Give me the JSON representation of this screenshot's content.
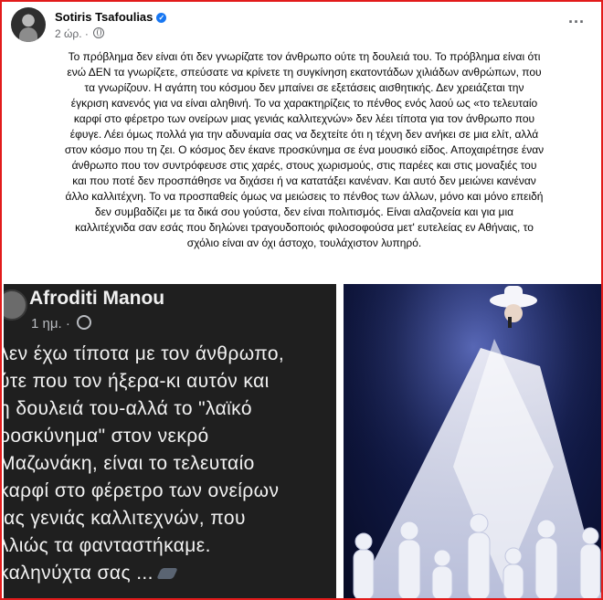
{
  "post": {
    "author": "Sotiris Tsafoulias",
    "time": "2 ώρ.",
    "lines": [
      "Το πρόβλημα δεν είναι ότι δεν γνωρίζατε τον άνθρωπο ούτε τη δουλειά του. Το πρόβλημα είναι ότι",
      "ενώ ΔΕΝ τα γνωρίζετε, σπεύσατε να κρίνετε τη συγκίνηση εκατοντάδων χιλιάδων ανθρώπων, που",
      "τα γνωρίζουν. Η αγάπη του κόσμου δεν μπαίνει σε εξετάσεις αισθητικής. Δεν χρειάζεται την",
      "έγκριση κανενός για να είναι αληθινή. Το να χαρακτηρίζεις το πένθος ενός λαού ως «το τελευταίο",
      "καρφί στο φέρετρο των ονείρων μιας γενιάς καλλιτεχνών» δεν λέει τίποτα για τον άνθρωπο που",
      "έφυγε. Λέει όμως πολλά για την αδυναμία σας να δεχτείτε ότι η τέχνη δεν ανήκει σε μια ελίτ, αλλά",
      "στον κόσμο που τη ζει. Ο κόσμος δεν έκανε προσκύνημα σε ένα μουσικό είδος. Αποχαιρέτησε έναν",
      "άνθρωπο που τον συντρόφευσε στις χαρές, στους χωρισμούς, στις παρέες και στις μοναξιές του",
      "και που ποτέ δεν προσπάθησε να διχάσει ή να κατατάξει κανέναν. Και αυτό δεν μειώνει κανέναν",
      "άλλο καλλιτέχνη. Το να προσπαθείς όμως να μειώσεις το πένθος των άλλων, μόνο και μόνο επειδή",
      "δεν συμβαδίζει με τα δικά σου γούστα, δεν είναι πολιτισμός. Είναι αλαζονεία και για μια",
      "καλλιτέχνιδα σαν εσάς που δηλώνει τραγουδοποιός φιλοσοφούσα μετ' ευτελείας εν Αθήναις, το",
      "σχόλιο είναι αν όχι άστοχο, τουλάχιστον λυπηρό."
    ]
  },
  "comment": {
    "author": "Afroditi Manou",
    "time": "1 ημ.",
    "lines": [
      "λεν έχω τίποτα με τον άνθρωπο,",
      "ύτε που τον ήξερα-κι αυτόν και",
      "η δουλειά του-αλλά το \"λαϊκό",
      "ροσκύνημα\" στον νεκρό",
      "Μαζωνάκη, είναι το τελευταίο",
      "καρφί στο φέρετρο των ονείρων",
      "ιας γενιάς καλλιτεχνών, που",
      "λλιώς τα φανταστήκαμε.",
      "καληνύχτα σας ..."
    ]
  },
  "icons": [
    "verified-badge-icon",
    "globe-icon",
    "more-options-icon"
  ],
  "colors": {
    "frame_border": "#e21b1b",
    "verified": "#1877f2",
    "comment_bg": "#1f1f1f",
    "stage_bg": "#121b4a"
  }
}
